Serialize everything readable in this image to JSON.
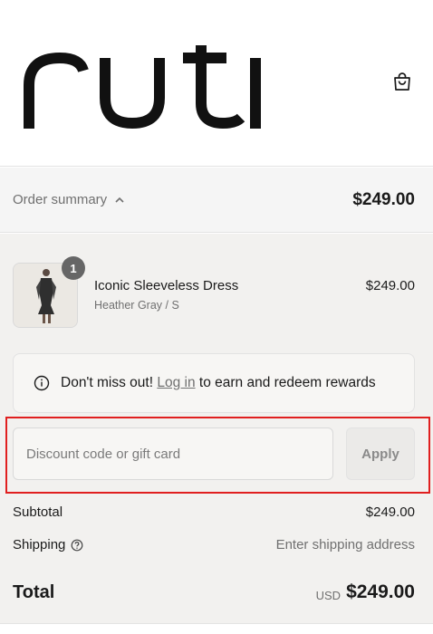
{
  "header": {
    "logo_text": "ruti",
    "cart_icon": "shopping-bag-icon"
  },
  "summary_toggle": {
    "label": "Order summary",
    "icon": "chevron-up-icon",
    "total": "$249.00"
  },
  "line_items": [
    {
      "quantity": "1",
      "name": "Iconic Sleeveless Dress",
      "variant": "Heather Gray / S",
      "price": "$249.00"
    }
  ],
  "rewards_notice": {
    "icon": "info-icon",
    "prefix": "Don't miss out!",
    "link_text": "Log in",
    "suffix": "to earn and redeem rewards"
  },
  "discount": {
    "placeholder": "Discount code or gift card",
    "value": "",
    "apply_label": "Apply"
  },
  "totals": {
    "subtotal_label": "Subtotal",
    "subtotal_value": "$249.00",
    "shipping_label": "Shipping",
    "shipping_icon": "help-circle-icon",
    "shipping_value": "Enter shipping address",
    "total_label": "Total",
    "currency": "USD",
    "total_value": "$249.00"
  },
  "colors": {
    "highlight": "#e01f1f",
    "panel_bg": "#f2f1ef",
    "muted_text": "#707070",
    "badge": "#666666"
  }
}
